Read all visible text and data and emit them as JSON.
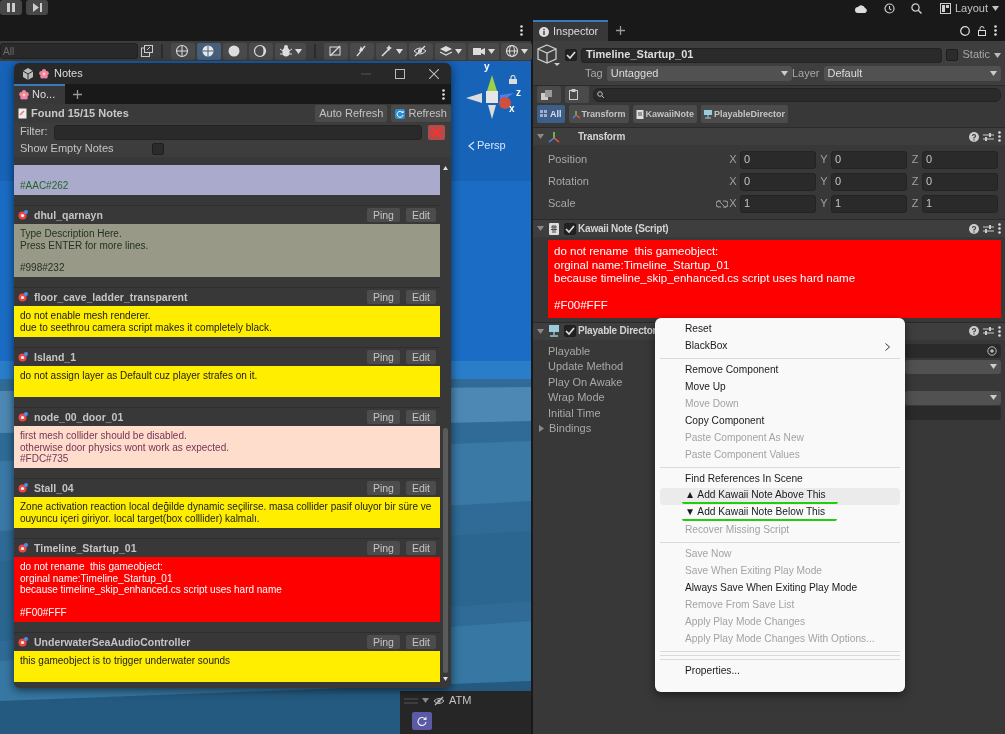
{
  "top_bar": {
    "layout_label": "Layout"
  },
  "scene": {
    "search": {
      "placeholder": "All"
    },
    "toolbar_groups": [
      [
        {
          "selected": false,
          "dropdown": false
        },
        {
          "selected": true,
          "dropdown": false
        },
        {
          "selected": false,
          "dropdown": false
        },
        {
          "selected": false,
          "dropdown": false
        },
        {
          "selected": false,
          "dropdown": true
        }
      ],
      [
        {
          "selected": false,
          "dropdown": false
        },
        {
          "selected": false,
          "dropdown": false
        },
        {
          "selected": false,
          "dropdown": true
        },
        {
          "selected": false,
          "dropdown": false
        },
        {
          "selected": false,
          "dropdown": true
        },
        {
          "selected": false,
          "dropdown": true
        },
        {
          "selected": false,
          "dropdown": true
        }
      ]
    ],
    "gizmo": {
      "axes": [
        "y",
        "z",
        "x"
      ],
      "view_label": "Persp"
    },
    "overlay": {
      "label": "ATM"
    }
  },
  "notes_window": {
    "title": "Notes",
    "tab": {
      "label": "No...",
      "selected": true
    },
    "found": "Found 15/15 Notes",
    "buttons": [
      "Auto Refresh",
      "Refresh"
    ],
    "filter": {
      "label": "Filter:"
    },
    "show_empty": {
      "label": "Show Empty Notes",
      "checked": false
    },
    "notes": [
      {
        "color": "#aaaacc",
        "body": {
          "text": "#AAC#262",
          "color": "#226622"
        }
      },
      {
        "object": "dhul_qarnayn",
        "buttons": [
          "Ping",
          "Edit"
        ],
        "color": "#999988",
        "body": {
          "text": "Type Description Here.\nPress ENTER for more lines.\n\n#998#232",
          "color": "#223322"
        }
      },
      {
        "object": "floor_cave_ladder_transparent",
        "buttons": [
          "Ping",
          "Edit"
        ],
        "color": "#ffee00",
        "body": {
          "text": "do not enable mesh renderer.\ndue to seethrou camera script makes it completely black."
        }
      },
      {
        "object": "Island_1",
        "buttons": [
          "Ping",
          "Edit"
        ],
        "color": "#ffee00",
        "body": {
          "text": "do not assign layer as Default cuz player strafes on it."
        }
      },
      {
        "object": "node_00_door_01",
        "buttons": [
          "Ping",
          "Edit"
        ],
        "color": "#ffddcc",
        "body": {
          "text": "first mesh collider should be disabled.\notherwise door physics wont work as expected.\n#FDC#735",
          "color": "#773355"
        }
      },
      {
        "object": "Stall_04",
        "buttons": [
          "Ping",
          "Edit"
        ],
        "color": "#ffee00",
        "body": {
          "text": "Zone activation reaction local değilde dynamic seçilirse. masa collider pasif oluyor bir süre ve ouyuncu içeri giriyor. local target(box colllider) kalmalı."
        }
      },
      {
        "object": "Timeline_Startup_01",
        "buttons": [
          "Ping",
          "Edit"
        ],
        "color": "#ff0000",
        "body": {
          "text": "do not rename  this gameobject:\norginal name:Timeline_Startup_01\nbecause timeline_skip_enhanced.cs script uses hard name\n\n#F00#FFF",
          "color": "#ffffff"
        }
      },
      {
        "object": "UnderwaterSeaAudioController",
        "buttons": [
          "Ping",
          "Edit"
        ],
        "color": "#ffee00",
        "body": {
          "text": "this gameobject is to trigger underwater sounds"
        }
      }
    ]
  },
  "inspector": {
    "tab": {
      "label": "Inspector",
      "selected": true
    },
    "object": {
      "active": true,
      "name": "Timeline_Startup_01",
      "static": {
        "label": "Static",
        "checked": false
      },
      "tag": {
        "label": "Tag",
        "value": "Untagged"
      },
      "layer": {
        "label": "Layer",
        "value": "Default"
      }
    },
    "filters": [
      {
        "label": "All",
        "selected": true
      },
      {
        "label": "Transform",
        "selected": false
      },
      {
        "label": "KawaiiNote",
        "selected": false
      },
      {
        "label": "PlayableDirector",
        "selected": false
      }
    ],
    "components": [
      {
        "kind": "transform",
        "title": "Transform",
        "expanded": true,
        "rows": [
          {
            "label": "Position",
            "fields": [
              {
                "axis": "X",
                "value": "0"
              },
              {
                "axis": "Y",
                "value": "0"
              },
              {
                "axis": "Z",
                "value": "0"
              }
            ]
          },
          {
            "label": "Rotation",
            "fields": [
              {
                "axis": "X",
                "value": "0"
              },
              {
                "axis": "Y",
                "value": "0"
              },
              {
                "axis": "Z",
                "value": "0"
              }
            ]
          },
          {
            "label": "Scale",
            "linked": false,
            "fields": [
              {
                "axis": "X",
                "value": "1"
              },
              {
                "axis": "Y",
                "value": "1"
              },
              {
                "axis": "Z",
                "value": "1"
              }
            ]
          }
        ]
      },
      {
        "kind": "note",
        "title": "Kawaii Note (Script)",
        "expanded": true,
        "enabled": true,
        "note": {
          "color": "#ff0000",
          "body": {
            "text": "do not rename  this gameobject:\norginal name:Timeline_Startup_01\nbecause timeline_skip_enhanced.cs script uses hard name\n\n#F00#FFF",
            "color": "#ffffff"
          }
        }
      },
      {
        "kind": "properties",
        "title": "Playable Director",
        "expanded": true,
        "enabled": true,
        "properties": [
          {
            "label": "Playable",
            "kind": "object"
          },
          {
            "label": "Update Method",
            "kind": "dropdown"
          },
          {
            "label": "Play On Awake",
            "kind": "hidden"
          },
          {
            "label": "Wrap Mode",
            "kind": "dropdown"
          },
          {
            "label": "Initial Time",
            "kind": "number"
          },
          {
            "label": "Bindings",
            "kind": "foldout",
            "expanded": false
          }
        ]
      }
    ]
  },
  "context_menu": {
    "items": [
      {
        "kind": "item",
        "label": "Reset",
        "disabled": false,
        "submenu": false,
        "selected": false,
        "underlined": false
      },
      {
        "kind": "item",
        "label": "BlackBox",
        "disabled": false,
        "submenu": true,
        "selected": false,
        "underlined": false
      },
      {
        "kind": "separator"
      },
      {
        "kind": "item",
        "label": "Remove Component",
        "disabled": false,
        "submenu": false,
        "selected": false,
        "underlined": false
      },
      {
        "kind": "item",
        "label": "Move Up",
        "disabled": false,
        "submenu": false,
        "selected": false,
        "underlined": false
      },
      {
        "kind": "item",
        "label": "Move Down",
        "disabled": true,
        "submenu": false,
        "selected": false,
        "underlined": false
      },
      {
        "kind": "item",
        "label": "Copy Component",
        "disabled": false,
        "submenu": false,
        "selected": false,
        "underlined": false
      },
      {
        "kind": "item",
        "label": "Paste Component As New",
        "disabled": true,
        "submenu": false,
        "selected": false,
        "underlined": false
      },
      {
        "kind": "item",
        "label": "Paste Component Values",
        "disabled": true,
        "submenu": false,
        "selected": false,
        "underlined": false
      },
      {
        "kind": "separator"
      },
      {
        "kind": "item",
        "label": "Find References In Scene",
        "disabled": false,
        "submenu": false,
        "selected": false,
        "underlined": false
      },
      {
        "kind": "item",
        "label": "▲ Add Kawaii Note Above This",
        "disabled": false,
        "submenu": false,
        "selected": true,
        "underlined": true
      },
      {
        "kind": "item",
        "label": "▼ Add Kawaii Note Below This",
        "disabled": false,
        "submenu": false,
        "selected": false,
        "underlined": true
      },
      {
        "kind": "item",
        "label": "Recover Missing Script",
        "disabled": true,
        "submenu": false,
        "selected": false,
        "underlined": false
      },
      {
        "kind": "separator"
      },
      {
        "kind": "item",
        "label": "Save Now",
        "disabled": true,
        "submenu": false,
        "selected": false,
        "underlined": false
      },
      {
        "kind": "item",
        "label": "Save When Exiting Play Mode",
        "disabled": true,
        "submenu": false,
        "selected": false,
        "underlined": false
      },
      {
        "kind": "item",
        "label": "Always Save When Exiting Play Mode",
        "disabled": false,
        "submenu": false,
        "selected": false,
        "underlined": false
      },
      {
        "kind": "item",
        "label": "Remove From Save List",
        "disabled": true,
        "submenu": false,
        "selected": false,
        "underlined": false
      },
      {
        "kind": "item",
        "label": "Apply Play Mode Changes",
        "disabled": true,
        "submenu": false,
        "selected": false,
        "underlined": false
      },
      {
        "kind": "item",
        "label": "Apply Play Mode Changes With Options...",
        "disabled": true,
        "submenu": false,
        "selected": false,
        "underlined": false
      },
      {
        "kind": "separator"
      },
      {
        "kind": "separator"
      },
      {
        "kind": "separator"
      },
      {
        "kind": "item",
        "label": "Properties...",
        "disabled": false,
        "submenu": false,
        "selected": false,
        "underlined": false
      }
    ]
  }
}
